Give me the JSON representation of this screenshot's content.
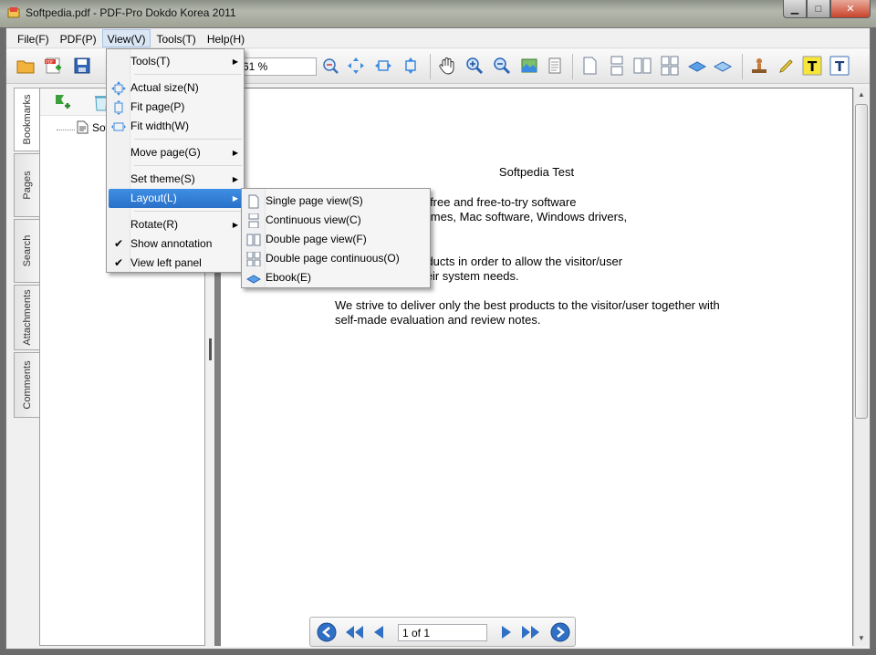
{
  "window": {
    "title": "Softpedia.pdf - PDF-Pro Dokdo Korea 2011",
    "minimize": "▁",
    "maximize": "□",
    "close": "✕"
  },
  "menubar": [
    "File(F)",
    "PDF(P)",
    "View(V)",
    "Tools(T)",
    "Help(H)"
  ],
  "toolbar": {
    "zoom_value": "61 %"
  },
  "left_tabs": [
    "Bookmarks",
    "Pages",
    "Search",
    "Attachments",
    "Comments"
  ],
  "bookmarks": {
    "item": "Softp"
  },
  "view_menu": {
    "items": [
      {
        "label": "Tools(T)",
        "submenu": true
      },
      {
        "label": "Actual size(N)",
        "icon": "actual-size-icon"
      },
      {
        "label": "Fit page(P)",
        "icon": "fit-page-icon"
      },
      {
        "label": "Fit width(W)",
        "icon": "fit-width-icon"
      },
      {
        "label": "Move page(G)",
        "submenu": true
      },
      {
        "label": "Set theme(S)",
        "submenu": true
      },
      {
        "label": "Layout(L)",
        "submenu": true,
        "highlighted": true
      },
      {
        "label": "Rotate(R)",
        "submenu": true
      },
      {
        "label": "Show annotation",
        "checked": true
      },
      {
        "label": "View left panel",
        "checked": true
      }
    ]
  },
  "layout_menu": {
    "items": [
      {
        "label": "Single page view(S)",
        "icon": "single-page-icon"
      },
      {
        "label": "Continuous view(C)",
        "icon": "continuous-icon"
      },
      {
        "label": "Double page view(F)",
        "icon": "double-page-icon"
      },
      {
        "label": "Double page continuous(O)",
        "icon": "double-continuous-icon"
      },
      {
        "label": "Ebook(E)",
        "icon": "ebook-icon"
      }
    ]
  },
  "document": {
    "title": "Softpedia Test",
    "para1": "y of over 300,000 free and free-to-try software\nows and Linux, games, Mac software, Windows drivers,\nIT-related articles.",
    "para2": "egorize these products in order to allow the visitor/user\noduct they and their system needs.",
    "para3": "We strive to deliver only the best products to the visitor/user together with\nself-made evaluation and review notes."
  },
  "navigation": {
    "page_display": "1 of 1"
  },
  "colors": {
    "accent": "#2a70c9",
    "nav_blue": "#2f6fc4"
  }
}
